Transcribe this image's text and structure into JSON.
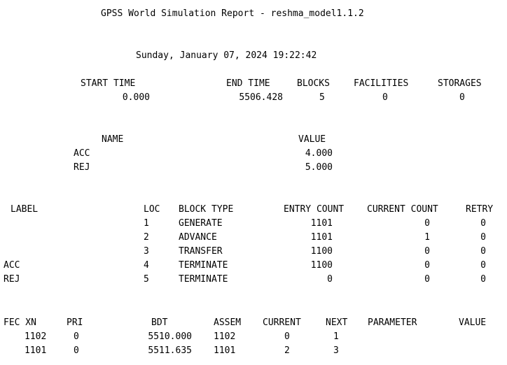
{
  "report": {
    "title": "GPSS World Simulation Report - reshma_model1.1.2",
    "datetime": "Sunday, January 07, 2024 19:22:42"
  },
  "summary": {
    "headers": [
      "START TIME",
      "END TIME",
      "BLOCKS",
      "FACILITIES",
      "STORAGES"
    ],
    "values": [
      "0.000",
      "5506.428",
      "5",
      "0",
      "0"
    ]
  },
  "names": {
    "headers": [
      "NAME",
      "VALUE"
    ],
    "rows": [
      {
        "name": "ACC",
        "value": "4.000"
      },
      {
        "name": "REJ",
        "value": "5.000"
      }
    ]
  },
  "blocks": {
    "headers": [
      "LABEL",
      "LOC",
      "BLOCK TYPE",
      "ENTRY COUNT",
      "CURRENT COUNT",
      "RETRY"
    ],
    "rows": [
      {
        "label": "",
        "loc": "1",
        "type": "GENERATE",
        "entry": "1101",
        "current": "0",
        "retry": "0"
      },
      {
        "label": "",
        "loc": "2",
        "type": "ADVANCE",
        "entry": "1101",
        "current": "1",
        "retry": "0"
      },
      {
        "label": "",
        "loc": "3",
        "type": "TRANSFER",
        "entry": "1100",
        "current": "0",
        "retry": "0"
      },
      {
        "label": "ACC",
        "loc": "4",
        "type": "TERMINATE",
        "entry": "1100",
        "current": "0",
        "retry": "0"
      },
      {
        "label": "REJ",
        "loc": "5",
        "type": "TERMINATE",
        "entry": "0",
        "current": "0",
        "retry": "0"
      }
    ]
  },
  "fec": {
    "headers": [
      "FEC XN",
      "PRI",
      "BDT",
      "ASSEM",
      "CURRENT",
      "NEXT",
      "PARAMETER",
      "VALUE"
    ],
    "rows": [
      {
        "xn": "1102",
        "pri": "0",
        "bdt": "5510.000",
        "assem": "1102",
        "current": "0",
        "next": "1"
      },
      {
        "xn": "1101",
        "pri": "0",
        "bdt": "5511.635",
        "assem": "1101",
        "current": "2",
        "next": "3"
      }
    ]
  }
}
